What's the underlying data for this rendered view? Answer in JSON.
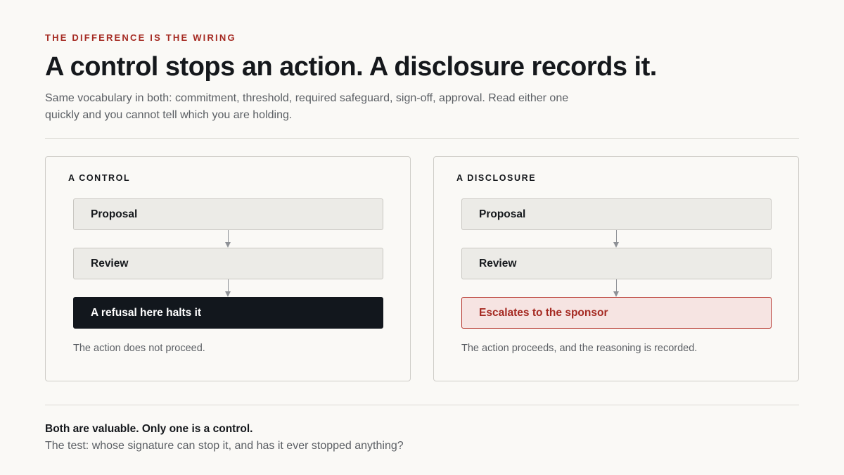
{
  "header": {
    "eyebrow": "THE DIFFERENCE IS THE WIRING",
    "title": "A control stops an action. A disclosure records it.",
    "subtitle": "Same vocabulary in both: commitment, threshold, required safeguard, sign-off, approval. Read either one quickly and you cannot tell which you are holding."
  },
  "panels": [
    {
      "label": "A CONTROL",
      "steps": [
        "Proposal",
        "Review",
        "A refusal here halts it"
      ],
      "outcome": "The action does not proceed."
    },
    {
      "label": "A DISCLOSURE",
      "steps": [
        "Proposal",
        "Review",
        "Escalates to the sponsor"
      ],
      "outcome": "The action proceeds, and the reasoning is recorded."
    }
  ],
  "footer": {
    "conclusion": "Both are valuable. Only one is a control.",
    "test": "The test: whose signature can stop it, and has it ever stopped anything?"
  },
  "colors": {
    "accent": "#a52a22",
    "halt_fill": "#12171d",
    "escalate_fill": "#f6e4e2",
    "escalate_border": "#b5322a",
    "step_fill": "#ecebe7"
  }
}
